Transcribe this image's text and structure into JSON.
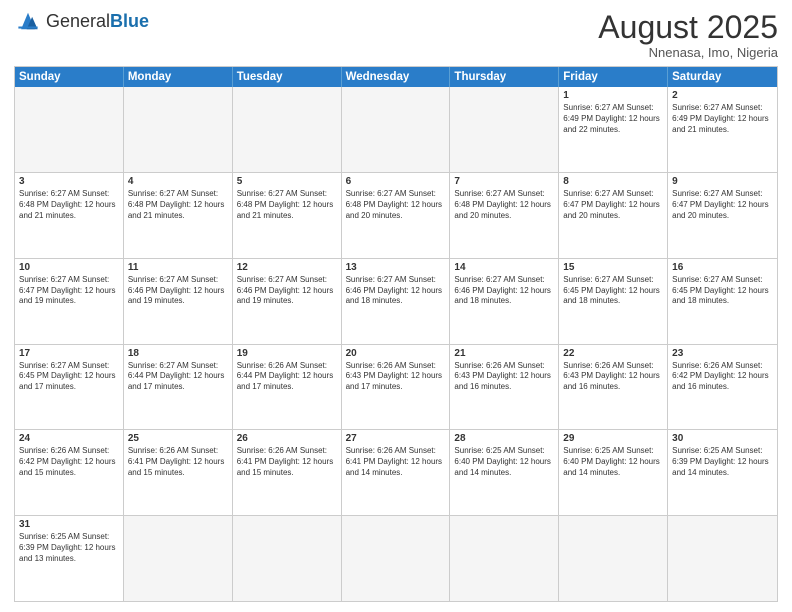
{
  "header": {
    "logo_general": "General",
    "logo_blue": "Blue",
    "month_title": "August 2025",
    "location": "Nnenasa, Imo, Nigeria"
  },
  "weekdays": [
    "Sunday",
    "Monday",
    "Tuesday",
    "Wednesday",
    "Thursday",
    "Friday",
    "Saturday"
  ],
  "rows": [
    [
      {
        "day": "",
        "info": "",
        "empty": true
      },
      {
        "day": "",
        "info": "",
        "empty": true
      },
      {
        "day": "",
        "info": "",
        "empty": true
      },
      {
        "day": "",
        "info": "",
        "empty": true
      },
      {
        "day": "",
        "info": "",
        "empty": true
      },
      {
        "day": "1",
        "info": "Sunrise: 6:27 AM\nSunset: 6:49 PM\nDaylight: 12 hours and 22 minutes."
      },
      {
        "day": "2",
        "info": "Sunrise: 6:27 AM\nSunset: 6:49 PM\nDaylight: 12 hours and 21 minutes."
      }
    ],
    [
      {
        "day": "3",
        "info": "Sunrise: 6:27 AM\nSunset: 6:48 PM\nDaylight: 12 hours and 21 minutes."
      },
      {
        "day": "4",
        "info": "Sunrise: 6:27 AM\nSunset: 6:48 PM\nDaylight: 12 hours and 21 minutes."
      },
      {
        "day": "5",
        "info": "Sunrise: 6:27 AM\nSunset: 6:48 PM\nDaylight: 12 hours and 21 minutes."
      },
      {
        "day": "6",
        "info": "Sunrise: 6:27 AM\nSunset: 6:48 PM\nDaylight: 12 hours and 20 minutes."
      },
      {
        "day": "7",
        "info": "Sunrise: 6:27 AM\nSunset: 6:48 PM\nDaylight: 12 hours and 20 minutes."
      },
      {
        "day": "8",
        "info": "Sunrise: 6:27 AM\nSunset: 6:47 PM\nDaylight: 12 hours and 20 minutes."
      },
      {
        "day": "9",
        "info": "Sunrise: 6:27 AM\nSunset: 6:47 PM\nDaylight: 12 hours and 20 minutes."
      }
    ],
    [
      {
        "day": "10",
        "info": "Sunrise: 6:27 AM\nSunset: 6:47 PM\nDaylight: 12 hours and 19 minutes."
      },
      {
        "day": "11",
        "info": "Sunrise: 6:27 AM\nSunset: 6:46 PM\nDaylight: 12 hours and 19 minutes."
      },
      {
        "day": "12",
        "info": "Sunrise: 6:27 AM\nSunset: 6:46 PM\nDaylight: 12 hours and 19 minutes."
      },
      {
        "day": "13",
        "info": "Sunrise: 6:27 AM\nSunset: 6:46 PM\nDaylight: 12 hours and 18 minutes."
      },
      {
        "day": "14",
        "info": "Sunrise: 6:27 AM\nSunset: 6:46 PM\nDaylight: 12 hours and 18 minutes."
      },
      {
        "day": "15",
        "info": "Sunrise: 6:27 AM\nSunset: 6:45 PM\nDaylight: 12 hours and 18 minutes."
      },
      {
        "day": "16",
        "info": "Sunrise: 6:27 AM\nSunset: 6:45 PM\nDaylight: 12 hours and 18 minutes."
      }
    ],
    [
      {
        "day": "17",
        "info": "Sunrise: 6:27 AM\nSunset: 6:45 PM\nDaylight: 12 hours and 17 minutes."
      },
      {
        "day": "18",
        "info": "Sunrise: 6:27 AM\nSunset: 6:44 PM\nDaylight: 12 hours and 17 minutes."
      },
      {
        "day": "19",
        "info": "Sunrise: 6:26 AM\nSunset: 6:44 PM\nDaylight: 12 hours and 17 minutes."
      },
      {
        "day": "20",
        "info": "Sunrise: 6:26 AM\nSunset: 6:43 PM\nDaylight: 12 hours and 17 minutes."
      },
      {
        "day": "21",
        "info": "Sunrise: 6:26 AM\nSunset: 6:43 PM\nDaylight: 12 hours and 16 minutes."
      },
      {
        "day": "22",
        "info": "Sunrise: 6:26 AM\nSunset: 6:43 PM\nDaylight: 12 hours and 16 minutes."
      },
      {
        "day": "23",
        "info": "Sunrise: 6:26 AM\nSunset: 6:42 PM\nDaylight: 12 hours and 16 minutes."
      }
    ],
    [
      {
        "day": "24",
        "info": "Sunrise: 6:26 AM\nSunset: 6:42 PM\nDaylight: 12 hours and 15 minutes."
      },
      {
        "day": "25",
        "info": "Sunrise: 6:26 AM\nSunset: 6:41 PM\nDaylight: 12 hours and 15 minutes."
      },
      {
        "day": "26",
        "info": "Sunrise: 6:26 AM\nSunset: 6:41 PM\nDaylight: 12 hours and 15 minutes."
      },
      {
        "day": "27",
        "info": "Sunrise: 6:26 AM\nSunset: 6:41 PM\nDaylight: 12 hours and 14 minutes."
      },
      {
        "day": "28",
        "info": "Sunrise: 6:25 AM\nSunset: 6:40 PM\nDaylight: 12 hours and 14 minutes."
      },
      {
        "day": "29",
        "info": "Sunrise: 6:25 AM\nSunset: 6:40 PM\nDaylight: 12 hours and 14 minutes."
      },
      {
        "day": "30",
        "info": "Sunrise: 6:25 AM\nSunset: 6:39 PM\nDaylight: 12 hours and 14 minutes."
      }
    ],
    [
      {
        "day": "31",
        "info": "Sunrise: 6:25 AM\nSunset: 6:39 PM\nDaylight: 12 hours and 13 minutes."
      },
      {
        "day": "",
        "info": "",
        "empty": true
      },
      {
        "day": "",
        "info": "",
        "empty": true
      },
      {
        "day": "",
        "info": "",
        "empty": true
      },
      {
        "day": "",
        "info": "",
        "empty": true
      },
      {
        "day": "",
        "info": "",
        "empty": true
      },
      {
        "day": "",
        "info": "",
        "empty": true
      }
    ]
  ]
}
